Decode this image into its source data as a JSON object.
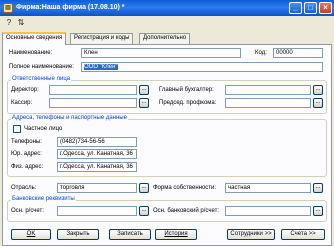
{
  "window": {
    "title": "Фирма:Наша фирма (17.08.10) *",
    "icon": "company-doc-icon"
  },
  "toolbar": {
    "icons": [
      "help-icon",
      "settings-icon"
    ]
  },
  "tabs": [
    "Основные сведения",
    "Регистрация и коды",
    "Дополнительно"
  ],
  "main": {
    "name_label": "Наименование:",
    "name_value": "Клен",
    "code_label": "Код:",
    "code_value": "00000",
    "fullname_label": "Полное наименование:",
    "fullname_value": "ООО \"Клен\"",
    "responsible": {
      "title": "Ответственные лица",
      "director_label": "Директор:",
      "director_value": "",
      "chief_accountant_label": "Главный бухгалтер:",
      "chief_accountant_value": "",
      "cashier_label": "Кассир:",
      "cashier_value": "",
      "union_chair_label": "Председ. профкома:",
      "union_chair_value": ""
    },
    "contacts": {
      "title": "Адреса, телефоны и паспортные данные",
      "private_person_label": "Частное лицо",
      "phones_label": "Телефоны:",
      "phones_value": "(0482)734-56-56",
      "legal_address_label": "Юр. адрес:",
      "legal_address_value": "г.Одесса, ул. Канатная, 36",
      "physical_address_label": "Физ. адрес:",
      "physical_address_value": "г.Одесса, ул. Канатная, 36"
    },
    "industry_label": "Отрасль:",
    "industry_value": "торговля",
    "ownership_label": "Форма собственности:",
    "ownership_value": "частная",
    "bank": {
      "title": "Банковские реквизиты",
      "main_account_label": "Осн. р/счет:",
      "main_account_value": "",
      "main_bank_account_label": "Осн. банковский р/счет:",
      "main_bank_account_value": ""
    }
  },
  "buttons": {
    "ok": "OK",
    "close": "Закрыть",
    "save": "Записать",
    "history": "История",
    "employees": "Сотрудники >>",
    "accounts": "Счета >>"
  }
}
